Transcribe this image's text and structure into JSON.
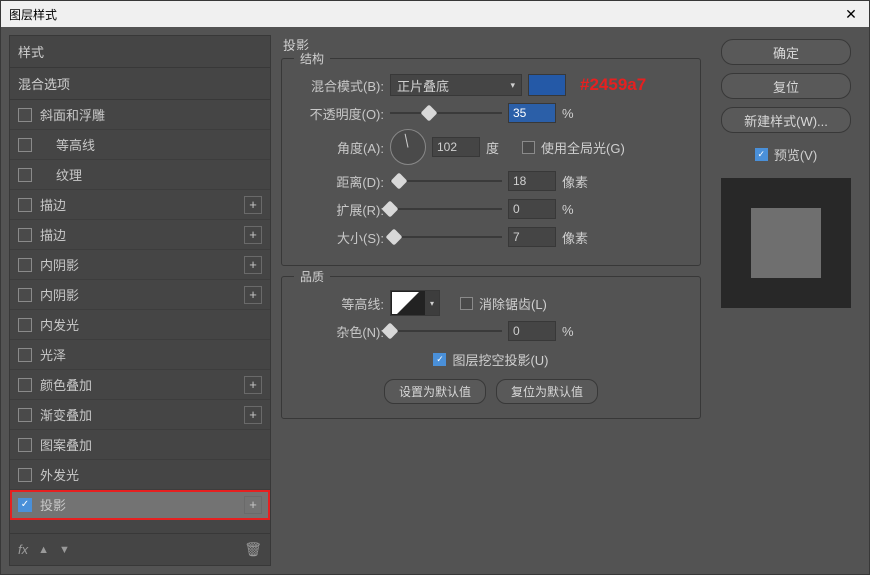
{
  "window": {
    "title": "图层样式",
    "close": "✕"
  },
  "annotation": {
    "hex": "#2459a7"
  },
  "left": {
    "styles_header": "样式",
    "blend_options": "混合选项",
    "items": [
      {
        "label": "斜面和浮雕",
        "checked": false,
        "indent": 0,
        "plus": false
      },
      {
        "label": "等高线",
        "checked": false,
        "indent": 1,
        "plus": false
      },
      {
        "label": "纹理",
        "checked": false,
        "indent": 1,
        "plus": false
      },
      {
        "label": "描边",
        "checked": false,
        "indent": 0,
        "plus": true
      },
      {
        "label": "描边",
        "checked": false,
        "indent": 0,
        "plus": true
      },
      {
        "label": "内阴影",
        "checked": false,
        "indent": 0,
        "plus": true
      },
      {
        "label": "内阴影",
        "checked": false,
        "indent": 0,
        "plus": true
      },
      {
        "label": "内发光",
        "checked": false,
        "indent": 0,
        "plus": false
      },
      {
        "label": "光泽",
        "checked": false,
        "indent": 0,
        "plus": false
      },
      {
        "label": "颜色叠加",
        "checked": false,
        "indent": 0,
        "plus": true
      },
      {
        "label": "渐变叠加",
        "checked": false,
        "indent": 0,
        "plus": true
      },
      {
        "label": "图案叠加",
        "checked": false,
        "indent": 0,
        "plus": false
      },
      {
        "label": "外发光",
        "checked": false,
        "indent": 0,
        "plus": false
      },
      {
        "label": "投影",
        "checked": true,
        "indent": 0,
        "plus": true,
        "selected": true,
        "highlight": true
      }
    ],
    "footer": {
      "fx": "fx",
      "up": "▲",
      "down": "▼",
      "trash": "🗑"
    }
  },
  "mid": {
    "section": "投影",
    "structure": {
      "title": "结构",
      "blend_mode_label": "混合模式(B):",
      "blend_mode_value": "正片叠底",
      "color": "#2459a7",
      "opacity_label": "不透明度(O):",
      "opacity_value": "35",
      "opacity_unit": "%",
      "angle_label": "角度(A):",
      "angle_value": "102",
      "angle_unit": "度",
      "global_light_label": "使用全局光(G)",
      "global_light_checked": false,
      "distance_label": "距离(D):",
      "distance_value": "18",
      "distance_unit": "像素",
      "spread_label": "扩展(R):",
      "spread_value": "0",
      "spread_unit": "%",
      "size_label": "大小(S):",
      "size_value": "7",
      "size_unit": "像素"
    },
    "quality": {
      "title": "品质",
      "contour_label": "等高线:",
      "antialias_label": "消除锯齿(L)",
      "antialias_checked": false,
      "noise_label": "杂色(N):",
      "noise_value": "0",
      "noise_unit": "%"
    },
    "knockout": {
      "label": "图层挖空投影(U)",
      "checked": true
    },
    "buttons": {
      "set_default": "设置为默认值",
      "reset_default": "复位为默认值"
    }
  },
  "right": {
    "ok": "确定",
    "cancel": "复位",
    "new_style": "新建样式(W)...",
    "preview_label": "预览(V)",
    "preview_checked": true
  }
}
